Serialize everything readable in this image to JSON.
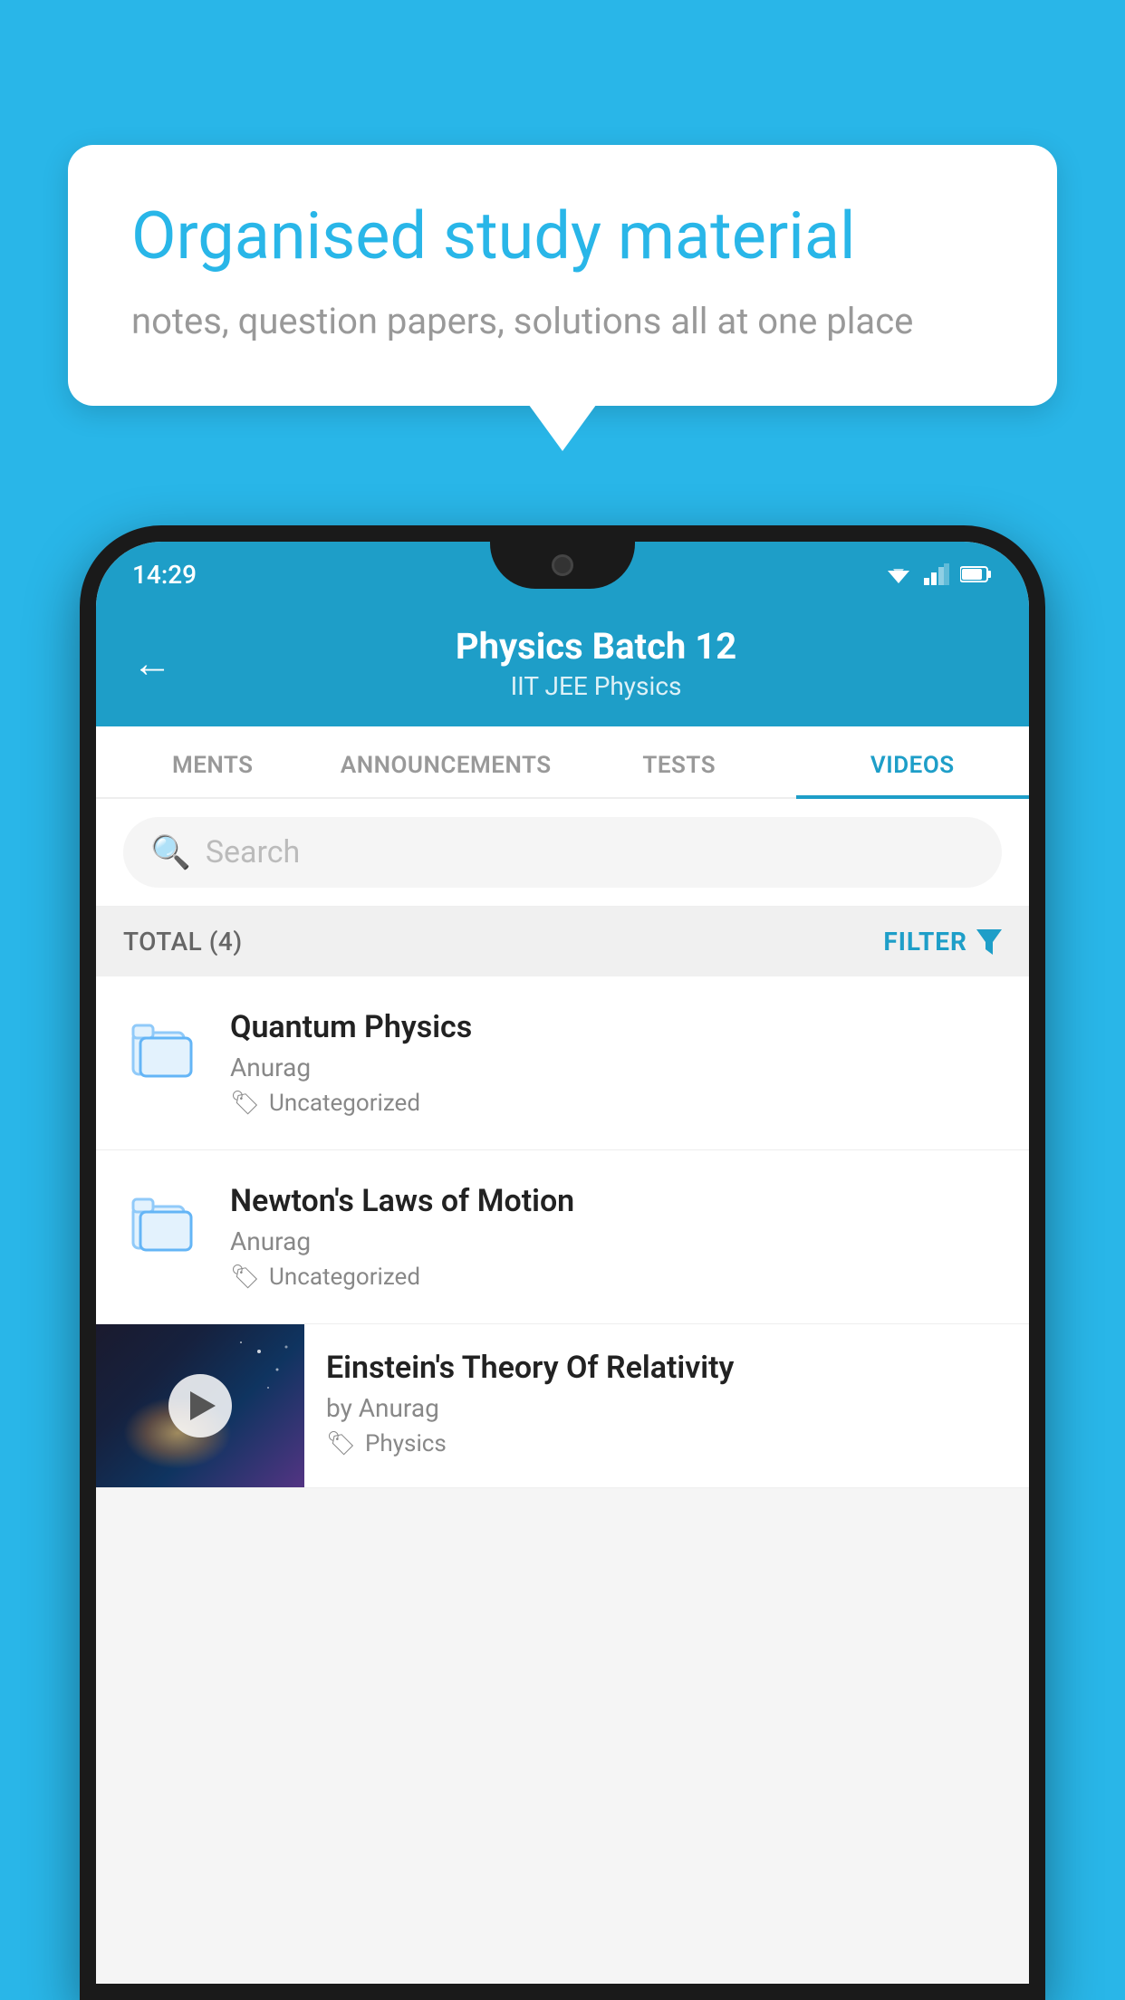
{
  "background_color": "#29b6e8",
  "speech_bubble": {
    "title": "Organised study material",
    "subtitle": "notes, question papers, solutions all at one place"
  },
  "status_bar": {
    "time": "14:29"
  },
  "app_header": {
    "back_label": "←",
    "title": "Physics Batch 12",
    "subtitle": "IIT JEE   Physics"
  },
  "tabs": [
    {
      "label": "MENTS",
      "active": false
    },
    {
      "label": "ANNOUNCEMENTS",
      "active": false
    },
    {
      "label": "TESTS",
      "active": false
    },
    {
      "label": "VIDEOS",
      "active": true
    }
  ],
  "search": {
    "placeholder": "Search"
  },
  "filter_bar": {
    "total_label": "TOTAL (4)",
    "filter_label": "FILTER"
  },
  "video_items": [
    {
      "title": "Quantum Physics",
      "author": "Anurag",
      "tag": "Uncategorized",
      "has_thumbnail": false
    },
    {
      "title": "Newton's Laws of Motion",
      "author": "Anurag",
      "tag": "Uncategorized",
      "has_thumbnail": false
    },
    {
      "title": "Einstein's Theory Of Relativity",
      "author": "by Anurag",
      "tag": "Physics",
      "has_thumbnail": true
    }
  ],
  "icons": {
    "search": "🔍",
    "tag": "🏷",
    "filter_funnel": "▼"
  }
}
